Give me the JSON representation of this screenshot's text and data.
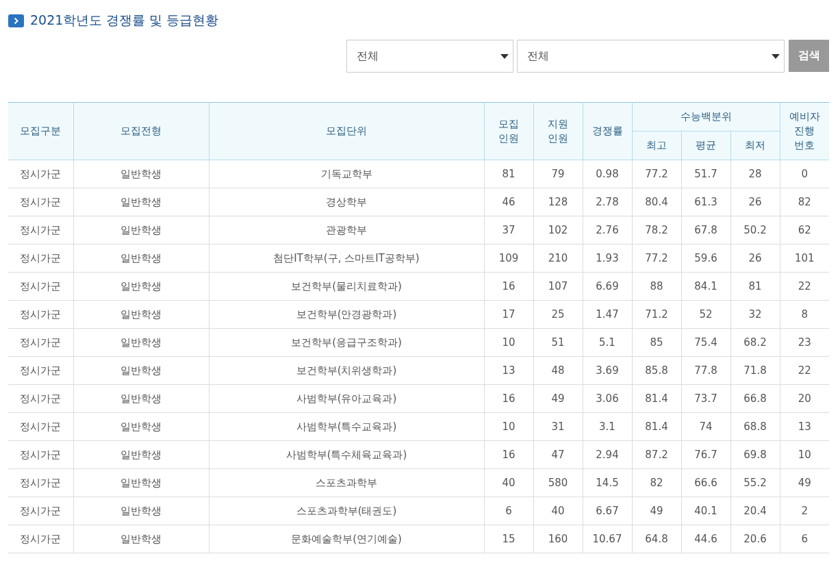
{
  "title": "2021학년도 경쟁률 및 등급현황",
  "filters": [
    {
      "value": "전체"
    },
    {
      "value": "전체"
    }
  ],
  "search_button": "검색",
  "table": {
    "columns": [
      {
        "label": "모집구분"
      },
      {
        "label": "모집전형"
      },
      {
        "label": "모집단위"
      },
      {
        "label": "모집\n인원"
      },
      {
        "label": "지원\n인원"
      },
      {
        "label": "경쟁률"
      },
      {
        "label": "수능백분위",
        "colspan": 3,
        "children": [
          {
            "label": "최고"
          },
          {
            "label": "평균"
          },
          {
            "label": "최저"
          }
        ]
      },
      {
        "label": "예비자\n진행\n번호"
      }
    ],
    "rows": [
      [
        "정시가군",
        "일반학생",
        "기독교학부",
        "81",
        "79",
        "0.98",
        "77.2",
        "51.7",
        "28",
        "0"
      ],
      [
        "정시가군",
        "일반학생",
        "경상학부",
        "46",
        "128",
        "2.78",
        "80.4",
        "61.3",
        "26",
        "82"
      ],
      [
        "정시가군",
        "일반학생",
        "관광학부",
        "37",
        "102",
        "2.76",
        "78.2",
        "67.8",
        "50.2",
        "62"
      ],
      [
        "정시가군",
        "일반학생",
        "첨단IT학부(구, 스마트IT공학부)",
        "109",
        "210",
        "1.93",
        "77.2",
        "59.6",
        "26",
        "101"
      ],
      [
        "정시가군",
        "일반학생",
        "보건학부(물리치료학과)",
        "16",
        "107",
        "6.69",
        "88",
        "84.1",
        "81",
        "22"
      ],
      [
        "정시가군",
        "일반학생",
        "보건학부(안경광학과)",
        "17",
        "25",
        "1.47",
        "71.2",
        "52",
        "32",
        "8"
      ],
      [
        "정시가군",
        "일반학생",
        "보건학부(응급구조학과)",
        "10",
        "51",
        "5.1",
        "85",
        "75.4",
        "68.2",
        "23"
      ],
      [
        "정시가군",
        "일반학생",
        "보건학부(치위생학과)",
        "13",
        "48",
        "3.69",
        "85.8",
        "77.8",
        "71.8",
        "22"
      ],
      [
        "정시가군",
        "일반학생",
        "사범학부(유아교육과)",
        "16",
        "49",
        "3.06",
        "81.4",
        "73.7",
        "66.8",
        "20"
      ],
      [
        "정시가군",
        "일반학생",
        "사범학부(특수교육과)",
        "10",
        "31",
        "3.1",
        "81.4",
        "74",
        "68.8",
        "13"
      ],
      [
        "정시가군",
        "일반학생",
        "사범학부(특수체육교육과)",
        "16",
        "47",
        "2.94",
        "87.2",
        "76.7",
        "69.8",
        "10"
      ],
      [
        "정시가군",
        "일반학생",
        "스포츠과학부",
        "40",
        "580",
        "14.5",
        "82",
        "66.6",
        "55.2",
        "49"
      ],
      [
        "정시가군",
        "일반학생",
        "스포츠과학부(태권도)",
        "6",
        "40",
        "6.67",
        "49",
        "40.1",
        "20.4",
        "2"
      ],
      [
        "정시가군",
        "일반학생",
        "문화예술학부(연기예술)",
        "15",
        "160",
        "10.67",
        "64.8",
        "44.6",
        "20.6",
        "6"
      ]
    ]
  }
}
